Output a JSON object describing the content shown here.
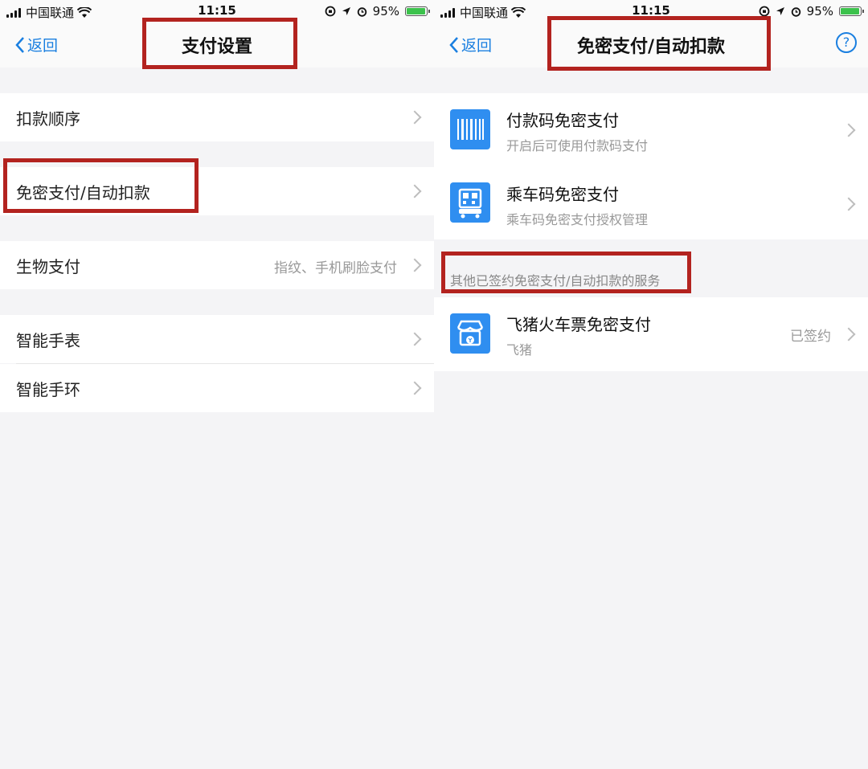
{
  "status_bar": {
    "carrier": "中国联通",
    "time": "11:15",
    "battery": "95%"
  },
  "left_screen": {
    "back_label": "返回",
    "title": "支付设置",
    "items": [
      {
        "label": "扣款顺序",
        "value": ""
      },
      {
        "label": "免密支付/自动扣款",
        "value": ""
      },
      {
        "label": "生物支付",
        "value": "指纹、手机刷脸支付"
      },
      {
        "label": "智能手表",
        "value": ""
      },
      {
        "label": "智能手环",
        "value": ""
      }
    ]
  },
  "right_screen": {
    "back_label": "返回",
    "title": "免密支付/自动扣款",
    "help_icon": "?",
    "items": [
      {
        "title": "付款码免密支付",
        "subtitle": "开启后可使用付款码支付",
        "icon": "barcode-icon"
      },
      {
        "title": "乘车码免密支付",
        "subtitle": "乘车码免密支付授权管理",
        "icon": "bus-qr-icon"
      }
    ],
    "section_header": "其他已签约免密支付/自动扣款的服务",
    "signed": [
      {
        "title": "飞猪火车票免密支付",
        "subtitle": "飞猪",
        "status": "已签约",
        "icon": "fliggy-shop-icon"
      }
    ]
  },
  "colors": {
    "accent": "#1a7fe0",
    "highlight_box": "#b3231f",
    "icon_bg": "#2f8ef0",
    "background": "#f4f4f6"
  }
}
